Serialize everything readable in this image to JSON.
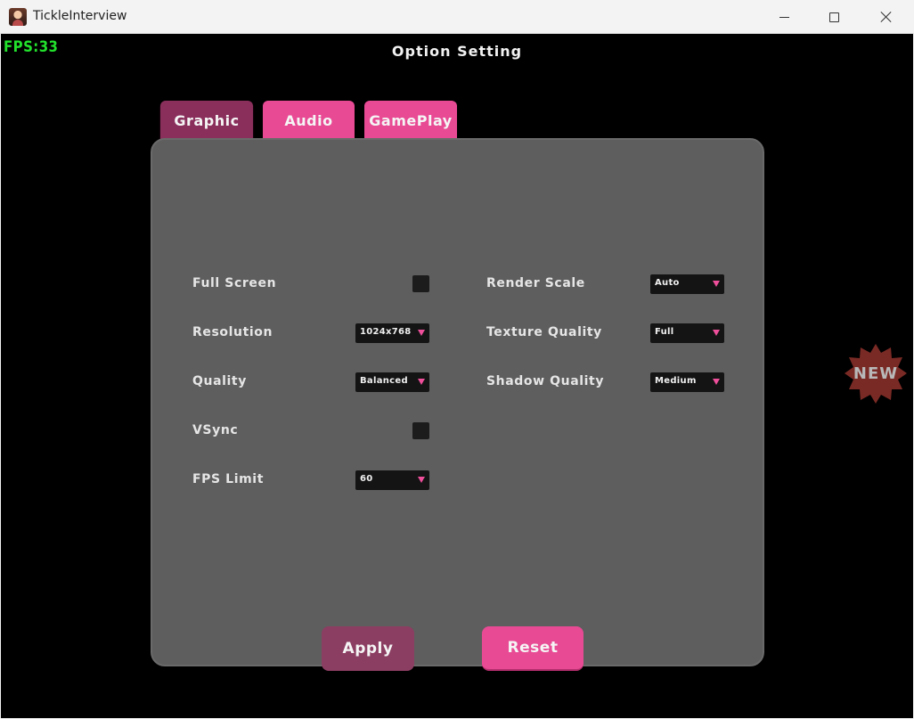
{
  "window": {
    "title": "TickleInterview",
    "icon": "app-portrait-icon",
    "controls": [
      "minimize-icon",
      "maximize-icon",
      "close-icon"
    ]
  },
  "hud": {
    "fps": "FPS:33",
    "fps_color": "#22e12c"
  },
  "screen": {
    "title": "Option Setting"
  },
  "tabs": [
    {
      "label": "Graphic",
      "active": true
    },
    {
      "label": "Audio",
      "active": false
    },
    {
      "label": "GamePlay",
      "active": false
    }
  ],
  "graphic": {
    "left": [
      {
        "label": "Full Screen",
        "control": "checkbox",
        "checked": false
      },
      {
        "label": "Resolution",
        "control": "dropdown",
        "value": "1024x768"
      },
      {
        "label": "Quality",
        "control": "dropdown",
        "value": "Balanced"
      },
      {
        "label": "VSync",
        "control": "checkbox",
        "checked": false
      },
      {
        "label": "FPS Limit",
        "control": "dropdown",
        "value": "60"
      }
    ],
    "right": [
      {
        "label": "Render Scale",
        "control": "dropdown",
        "value": "Auto"
      },
      {
        "label": "Texture Quality",
        "control": "dropdown",
        "value": "Full"
      },
      {
        "label": "Shadow Quality",
        "control": "dropdown",
        "value": "Medium"
      }
    ]
  },
  "buttons": {
    "apply": "Apply",
    "reset": "Reset"
  },
  "badge": {
    "text": "NEW"
  },
  "colors": {
    "accent": "#e84a94",
    "accent_active": "#8a2f5c",
    "panel": "#5e5e5e",
    "background": "#000000",
    "badge": "#7a2a25"
  }
}
